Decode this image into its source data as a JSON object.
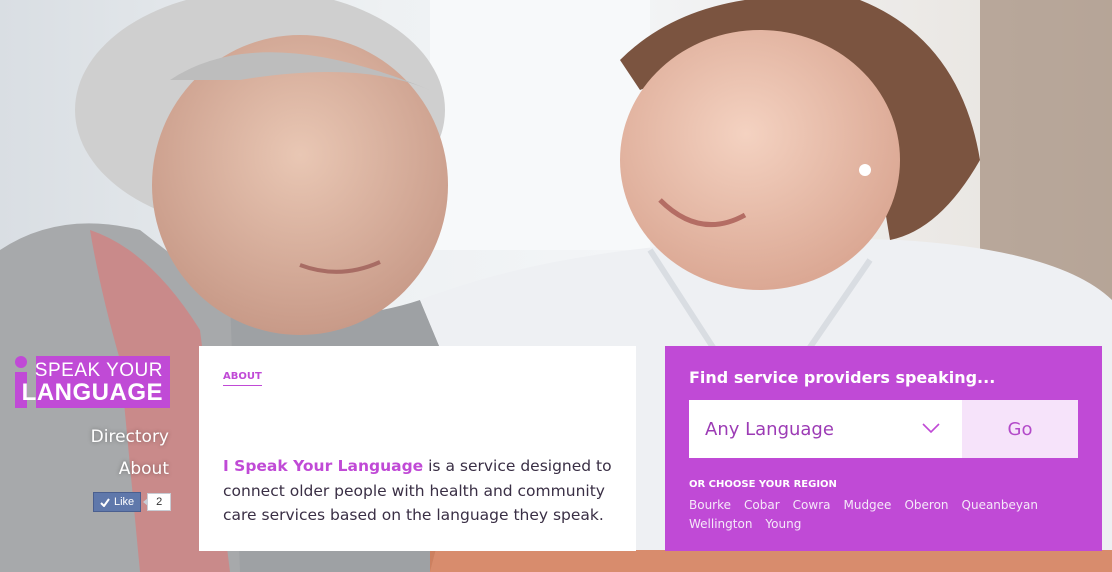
{
  "logo": {
    "line1": "SPEAK YOUR",
    "line2": "LANGUAGE"
  },
  "nav": {
    "directory": "Directory",
    "about": "About"
  },
  "facebook": {
    "like_label": "Like",
    "count": "2"
  },
  "about": {
    "heading": "ABOUT",
    "brand": "I Speak Your Language",
    "text": " is a service designed to connect older people with health and community care services based on the language they speak."
  },
  "search": {
    "title": "Find service providers speaking...",
    "select_value": "Any Language",
    "go_label": "Go",
    "region_label": "OR CHOOSE YOUR REGION",
    "regions": [
      "Bourke",
      "Cobar",
      "Cowra",
      "Mudgee",
      "Oberon",
      "Queanbeyan",
      "Wellington",
      "Young"
    ]
  },
  "colors": {
    "accent": "#c04ad6",
    "go_bg": "#f6e3fa"
  },
  "icons": {
    "select_arrow": "chevron-down-icon",
    "like": "check-icon"
  }
}
